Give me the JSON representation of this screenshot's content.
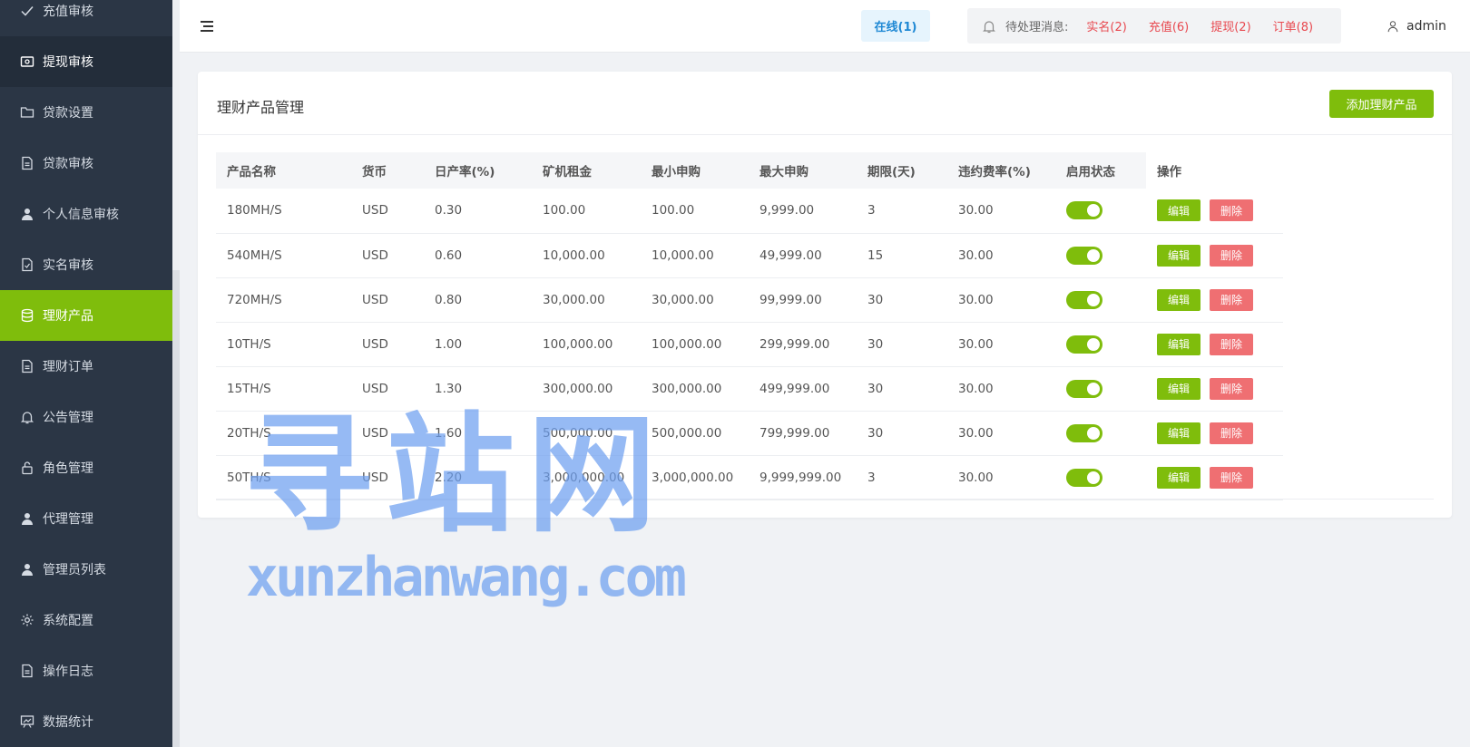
{
  "sidebar": {
    "items": [
      {
        "label": "充值审核",
        "icon": "check-icon"
      },
      {
        "label": "提现审核",
        "icon": "wallet-icon"
      },
      {
        "label": "贷款设置",
        "icon": "folder-icon"
      },
      {
        "label": "贷款审核",
        "icon": "document-icon"
      },
      {
        "label": "个人信息审核",
        "icon": "user-icon"
      },
      {
        "label": "实名审核",
        "icon": "doc-check-icon"
      },
      {
        "label": "理财产品",
        "icon": "database-icon"
      },
      {
        "label": "理财订单",
        "icon": "document-icon"
      },
      {
        "label": "公告管理",
        "icon": "bell-icon"
      },
      {
        "label": "角色管理",
        "icon": "lock-icon"
      },
      {
        "label": "代理管理",
        "icon": "user-icon"
      },
      {
        "label": "管理员列表",
        "icon": "user-icon"
      },
      {
        "label": "系统配置",
        "icon": "gear-icon"
      },
      {
        "label": "操作日志",
        "icon": "document-icon"
      },
      {
        "label": "数据统计",
        "icon": "chart-board-icon"
      }
    ],
    "active_index": 6
  },
  "header": {
    "online": "在线(1)",
    "notice_label": "待处理消息:",
    "notices": [
      "实名(2)",
      "充值(6)",
      "提现(2)",
      "订单(8)"
    ],
    "user": "admin"
  },
  "card": {
    "title": "理财产品管理",
    "add_button": "添加理财产品"
  },
  "table": {
    "columns": [
      "产品名称",
      "货币",
      "日产率(%)",
      "矿机租金",
      "最小申购",
      "最大申购",
      "期限(天)",
      "违约费率(%)",
      "启用状态",
      "操作"
    ],
    "rows": [
      {
        "name": "180MH/S",
        "currency": "USD",
        "rate": "0.30",
        "rent": "100.00",
        "min": "100.00",
        "max": "9,999.00",
        "days": "3",
        "penalty": "30.00",
        "enabled": true
      },
      {
        "name": "540MH/S",
        "currency": "USD",
        "rate": "0.60",
        "rent": "10,000.00",
        "min": "10,000.00",
        "max": "49,999.00",
        "days": "15",
        "penalty": "30.00",
        "enabled": true
      },
      {
        "name": "720MH/S",
        "currency": "USD",
        "rate": "0.80",
        "rent": "30,000.00",
        "min": "30,000.00",
        "max": "99,999.00",
        "days": "30",
        "penalty": "30.00",
        "enabled": true
      },
      {
        "name": "10TH/S",
        "currency": "USD",
        "rate": "1.00",
        "rent": "100,000.00",
        "min": "100,000.00",
        "max": "299,999.00",
        "days": "30",
        "penalty": "30.00",
        "enabled": true
      },
      {
        "name": "15TH/S",
        "currency": "USD",
        "rate": "1.30",
        "rent": "300,000.00",
        "min": "300,000.00",
        "max": "499,999.00",
        "days": "30",
        "penalty": "30.00",
        "enabled": true
      },
      {
        "name": "20TH/S",
        "currency": "USD",
        "rate": "1.60",
        "rent": "500,000.00",
        "min": "500,000.00",
        "max": "799,999.00",
        "days": "30",
        "penalty": "30.00",
        "enabled": true
      },
      {
        "name": "50TH/S",
        "currency": "USD",
        "rate": "2.20",
        "rent": "3,000,000.00",
        "min": "3,000,000.00",
        "max": "9,999,999.00",
        "days": "3",
        "penalty": "30.00",
        "enabled": true
      }
    ],
    "edit_label": "编辑",
    "delete_label": "删除"
  },
  "watermark": {
    "main": "寻站网",
    "sub": "xunzhanwang.com"
  },
  "colors": {
    "accent": "#7fbd0c",
    "sidebar_bg": "#2b3645",
    "danger": "#ef6f72",
    "notice": "#e8484f",
    "online": "#1e88d4"
  }
}
